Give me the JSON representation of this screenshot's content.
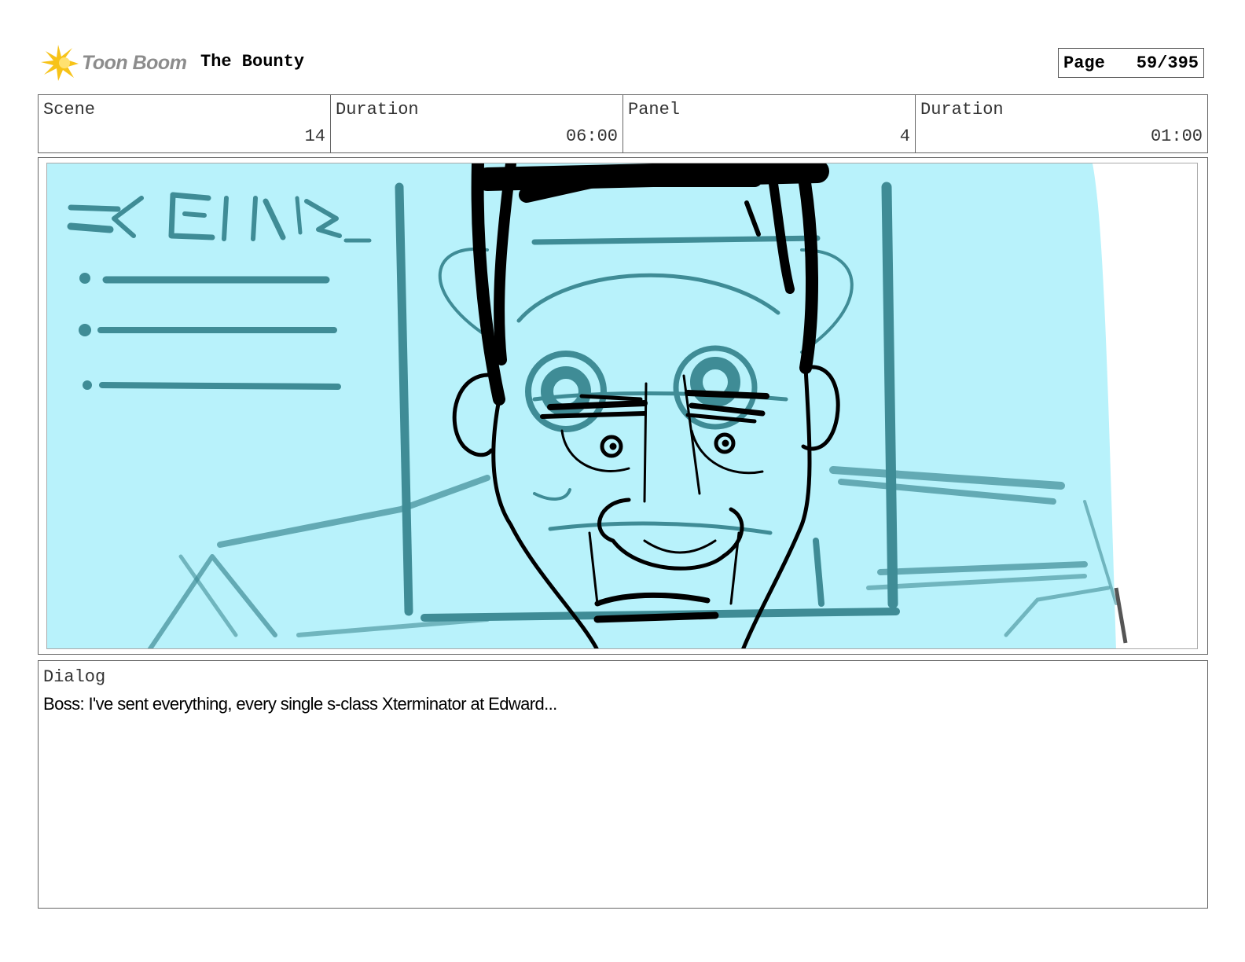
{
  "header": {
    "logo_text": "Toon Boom",
    "project_title": "The Bounty",
    "page_label": "Page",
    "page_value": "59/395"
  },
  "meta": {
    "scene_label": "Scene",
    "scene_value": "14",
    "scene_duration_label": "Duration",
    "scene_duration_value": "06:00",
    "panel_label": "Panel",
    "panel_value": "4",
    "panel_duration_label": "Duration",
    "panel_duration_value": "01:00"
  },
  "dialog": {
    "label": "Dialog",
    "text": "Boss: I've sent everything, every single s-class Xterminator at Edward..."
  },
  "colors": {
    "sketch_fill": "#b8f2fb",
    "sketch_teal": "#3f8c96",
    "logo_yellow": "#f7c318"
  },
  "icons": {
    "logo": "toon-boom-logo-icon",
    "sketch": "storyboard-sketch-illustration"
  }
}
